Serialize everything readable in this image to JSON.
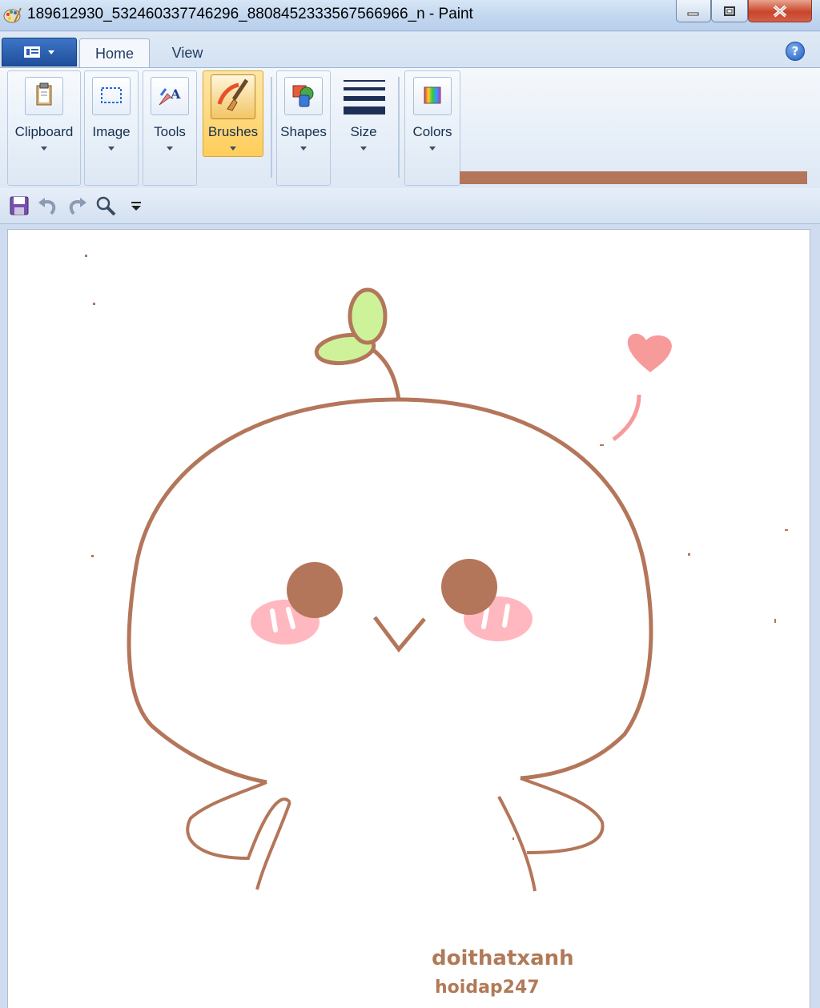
{
  "window": {
    "title": "189612930_532460337746296_8808452333567566966_n - Paint",
    "buttons": {
      "minimize": "minimize-icon",
      "maximize": "maximize-icon",
      "close": "close-icon"
    }
  },
  "ribbon": {
    "tabs": [
      {
        "label": "Home",
        "active": true
      },
      {
        "label": "View",
        "active": false
      }
    ],
    "groups": [
      {
        "label": "Clipboard",
        "icon": "clipboard-icon"
      },
      {
        "label": "Image",
        "icon": "select-icon"
      },
      {
        "label": "Tools",
        "icon": "tools-icon"
      },
      {
        "label": "Brushes",
        "icon": "brush-icon",
        "active": true
      },
      {
        "label": "Shapes",
        "icon": "shapes-icon"
      },
      {
        "label": "Size",
        "icon": "size-icon"
      },
      {
        "label": "Colors",
        "icon": "colors-icon"
      }
    ],
    "primary_color": "#b4765a"
  },
  "quick_access": [
    "save-icon",
    "undo-icon",
    "redo-icon",
    "zoom-icon",
    "customize-dropdown-icon"
  ],
  "canvas": {
    "text": [
      "doithatxanh",
      "hoidap247"
    ],
    "colors": {
      "outline": "#b4765a",
      "leaf": "#cdf29a",
      "blush": "#ffb8bf",
      "heart": "#f79a9a"
    }
  }
}
